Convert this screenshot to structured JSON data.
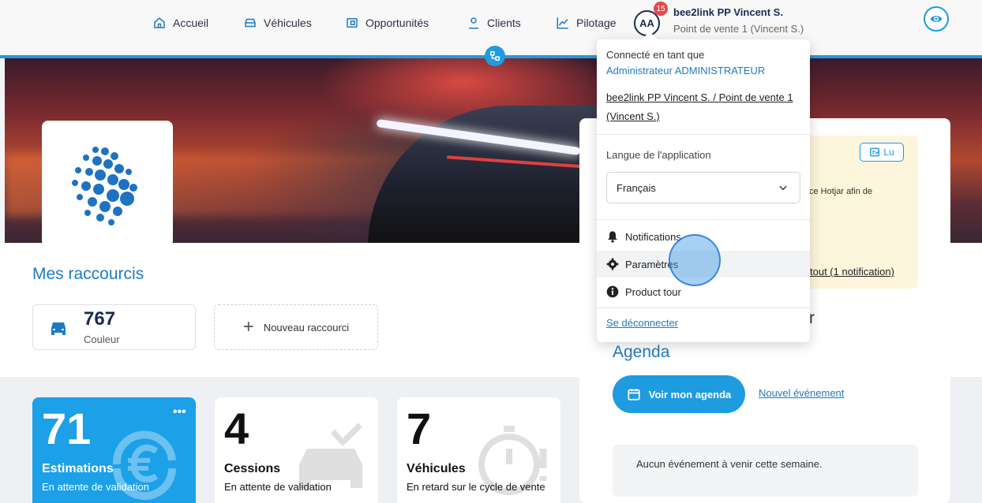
{
  "nav": {
    "items": [
      {
        "label": "Accueil",
        "icon": "home-icon"
      },
      {
        "label": "Véhicules",
        "icon": "car-icon"
      },
      {
        "label": "Opportunités",
        "icon": "wallet-icon"
      },
      {
        "label": "Clients",
        "icon": "user-icon"
      },
      {
        "label": "Pilotage",
        "icon": "chart-line-icon"
      }
    ],
    "avatar_initials": "AA",
    "notification_count": "15",
    "user_name": "bee2link PP Vincent S.",
    "user_store": "Point de vente 1 (Vincent S.)"
  },
  "dropdown": {
    "connected_as": "Connecté en tant que",
    "role": "Administrateur ADMINISTRATEUR",
    "store_link": "bee2link PP Vincent S. / Point de vente 1 (Vincent S.)",
    "language_label": "Langue de l'application",
    "language_value": "Français",
    "menu": [
      {
        "label": "Notifications",
        "icon": "bell-icon"
      },
      {
        "label": "Paramètres",
        "icon": "gear-icon"
      },
      {
        "label": "Product tour",
        "icon": "info-icon"
      }
    ],
    "logout": "Se déconnecter"
  },
  "shortcuts": {
    "title": "Mes raccourcis",
    "items": [
      {
        "value": "767",
        "label": "Couleur",
        "icon": "car-icon"
      }
    ],
    "new_label": "Nouveau raccourci"
  },
  "stats": [
    {
      "value": "71",
      "title": "Estimations",
      "sub": "En attente de validation",
      "icon": "euro-refresh-icon"
    },
    {
      "value": "4",
      "title": "Cessions",
      "sub": "En attente de validation",
      "icon": "car-check-icon"
    },
    {
      "value": "7",
      "title": "Véhicules",
      "sub": "En retard sur le cycle de vente",
      "icon": "stopwatch-icon"
    }
  ],
  "notification_panel": {
    "read_label": "Lu",
    "text": "ce Hotjar afin de",
    "link": "tout (1 notification)",
    "partial_heading": "r"
  },
  "agenda": {
    "title": "Agenda",
    "button": "Voir mon agenda",
    "new_event": "Nouvel événement",
    "empty": "Aucun événement à venir cette semaine."
  },
  "colors": {
    "accent": "#1f9be0",
    "title_blue": "#1f7bc1",
    "navy": "#1a2b50"
  }
}
